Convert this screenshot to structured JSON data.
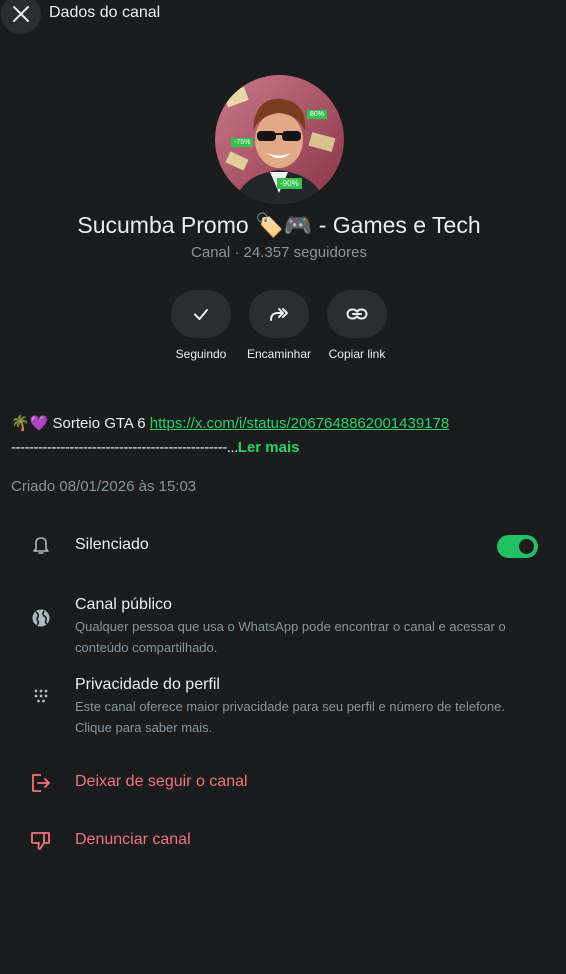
{
  "header": {
    "title": "Dados do canal"
  },
  "channel": {
    "name": "Sucumba Promo 🏷️🎮 - Games e Tech",
    "meta": "Canal · 24.357 seguidores",
    "avatar_badges": [
      "80%",
      "-75%",
      "-90%"
    ]
  },
  "actions": [
    {
      "label": "Seguindo",
      "icon": "check-icon"
    },
    {
      "label": "Encaminhar",
      "icon": "forward-icon"
    },
    {
      "label": "Copiar link",
      "icon": "link-icon"
    }
  ],
  "description": {
    "prefix": "🌴💜 Sorteio GTA 6 ",
    "link": "https://x.com/i/status/2067648862001439178",
    "dashes": "------------------------------------------------...",
    "more": "Ler mais"
  },
  "created": "Criado 08/01/2026 às 15:03",
  "settings": {
    "muted": {
      "title": "Silenciado",
      "icon": "bell-icon",
      "enabled": true
    },
    "public": {
      "title": "Canal público",
      "icon": "globe-icon",
      "description": "Qualquer pessoa que usa o WhatsApp pode encontrar o canal e acessar o conteúdo compartilhado."
    },
    "privacy": {
      "title": "Privacidade do perfil",
      "icon": "dots-grid-icon",
      "description": "Este canal oferece maior privacidade para seu perfil e número de telefone. Clique para saber mais."
    },
    "unfollow": {
      "title": "Deixar de seguir o canal",
      "icon": "exit-icon"
    },
    "report": {
      "title": "Denunciar canal",
      "icon": "thumbs-down-icon"
    }
  },
  "colors": {
    "background": "#1b1c1d",
    "accent": "#25d366",
    "danger": "#f1747d",
    "muted_text": "#8696a0"
  }
}
